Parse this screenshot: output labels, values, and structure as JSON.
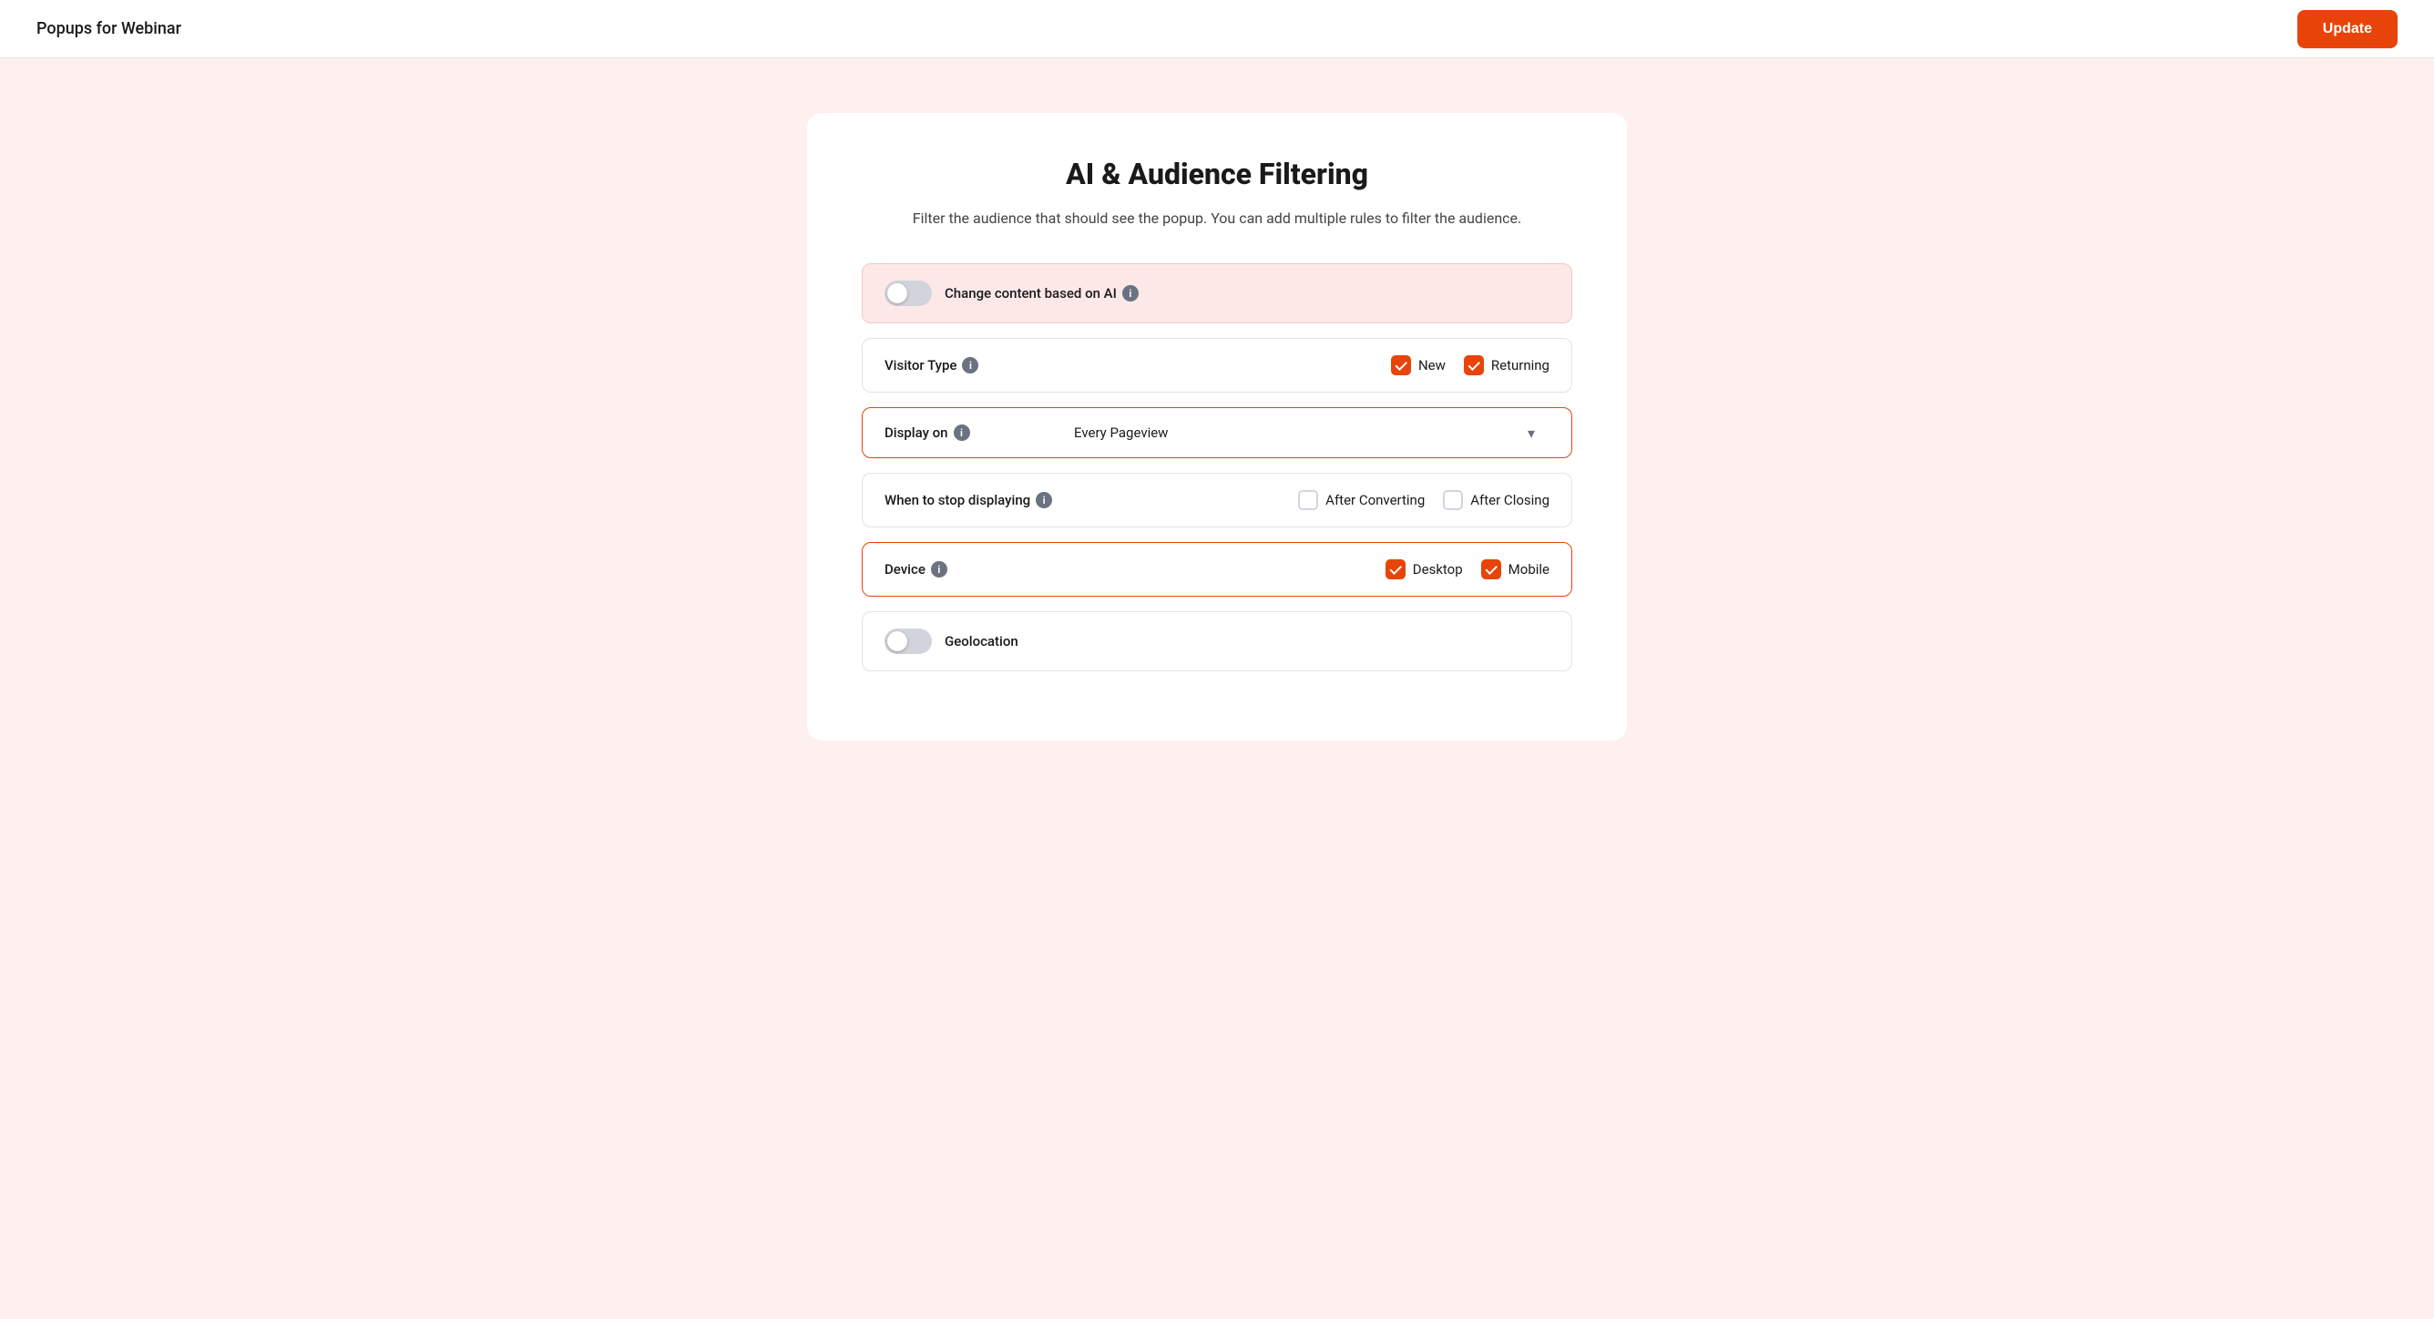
{
  "header": {
    "title": "Popups for Webinar",
    "update_button": "Update"
  },
  "card": {
    "title": "AI & Audience Filtering",
    "subtitle": "Filter the audience that should see the popup. You can add multiple rules to filter the audience."
  },
  "rows": {
    "ai_change": {
      "label": "Change content based on AI",
      "toggle_active": false
    },
    "visitor_type": {
      "label": "Visitor Type",
      "new_checked": true,
      "new_label": "New",
      "returning_checked": true,
      "returning_label": "Returning"
    },
    "display_on": {
      "label": "Display on",
      "value": "Every Pageview"
    },
    "stop_displaying": {
      "label": "When to stop displaying",
      "after_converting_label": "After Converting",
      "after_converting_checked": false,
      "after_closing_label": "After Closing",
      "after_closing_checked": false
    },
    "device": {
      "label": "Device",
      "desktop_checked": true,
      "desktop_label": "Desktop",
      "mobile_checked": true,
      "mobile_label": "Mobile"
    },
    "geolocation": {
      "label": "Geolocation",
      "toggle_active": false
    }
  },
  "icons": {
    "info": "i",
    "check": "✓",
    "chevron_down": "▾"
  }
}
